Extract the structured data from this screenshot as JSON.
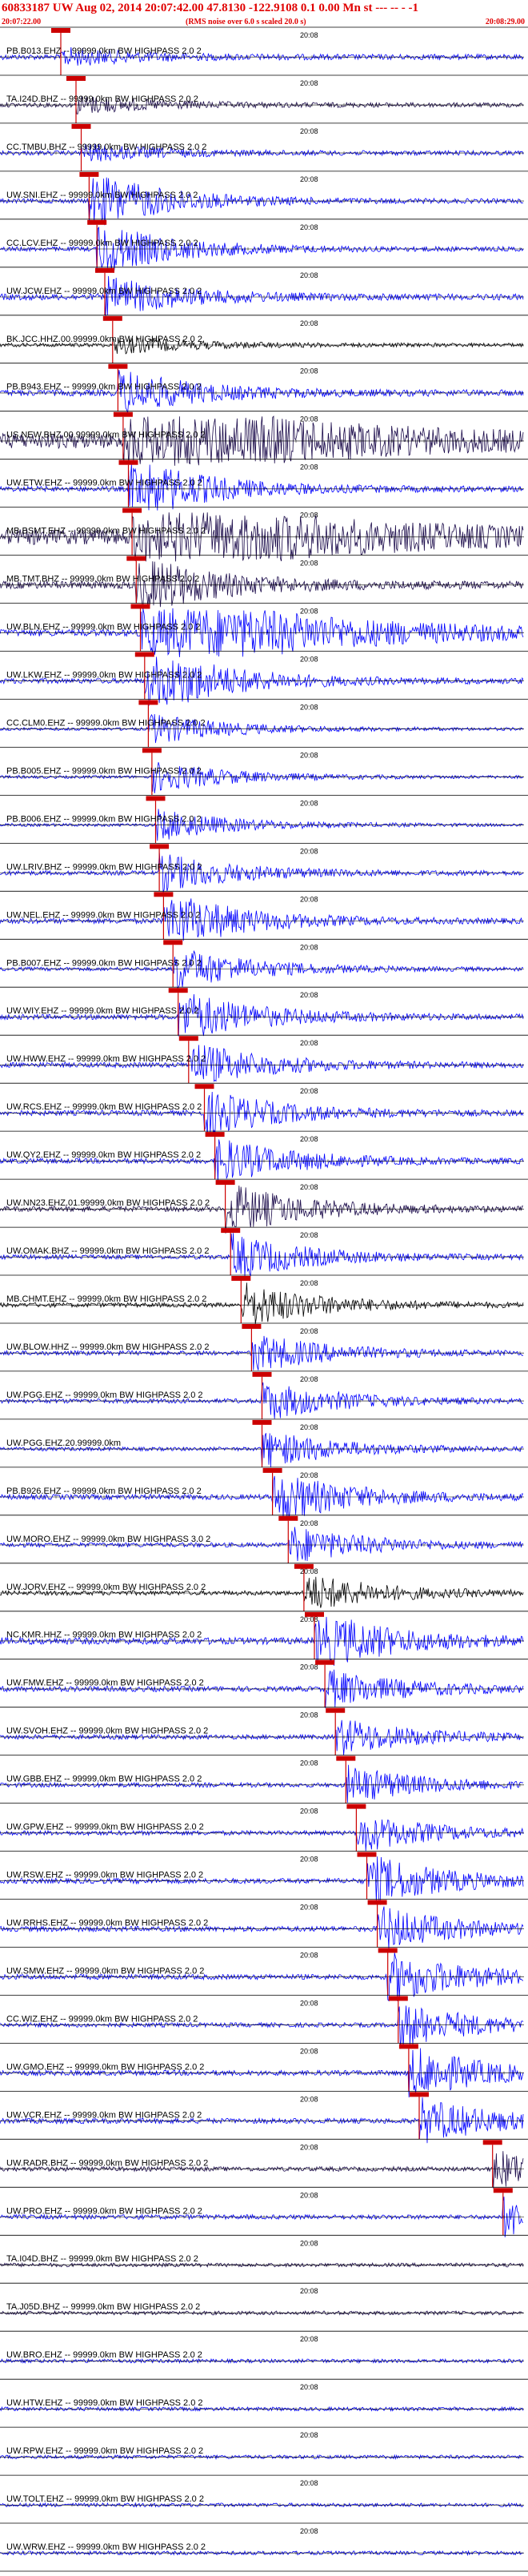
{
  "header": {
    "title": "60833187 UW Aug 02, 2014 20:07:42.00    47.8130  -122.9108   0.1  0.00  Mn  st --- --  -  -1",
    "start_time": "20:07:22.00",
    "note": "(RMS noise over 6.0 s scaled 20.0 s)",
    "end_time": "20:08:29.00"
  },
  "colors": {
    "header": "#e00000",
    "blue": "#0000ff",
    "black": "#000000",
    "purple": "#1a0a4a",
    "marker": "#cc0000"
  },
  "chart_data": {
    "type": "seismogram",
    "time_tick_label": "20:08",
    "traces": [
      {
        "label": "PB.B013.EHZ -- 99999.0km BW  HIGHPASS  2.0  2",
        "color": "blue",
        "pick": 0.116,
        "amp": 0.35,
        "burst": 0.0
      },
      {
        "label": "TA.I24D.BHZ -- 99999.0km BW  HIGHPASS  2.0  2",
        "color": "purple",
        "pick": 0.145,
        "amp": 0.3,
        "burst": 0.0
      },
      {
        "label": "CC.TMBU.BHZ -- 99999.0km BW  HIGHPASS  2.0  2",
        "color": "blue",
        "pick": 0.155,
        "amp": 0.3,
        "burst": 0.0
      },
      {
        "label": "UW.SNI.EHZ -- 99999.0km BW  HIGHPASS  2.0  2",
        "color": "blue",
        "pick": 0.17,
        "amp": 0.3,
        "burst": 0.6
      },
      {
        "label": "CC.LCV.EHZ -- 99999.0km BW  HIGHPASS  2.0  2",
        "color": "blue",
        "pick": 0.185,
        "amp": 0.3,
        "burst": 0.5
      },
      {
        "label": "UW.JCW.EHZ -- 99999.0km BW  HIGHPASS  2.0  2",
        "color": "blue",
        "pick": 0.2,
        "amp": 0.4,
        "burst": 0.3
      },
      {
        "label": "BK.JCC.HHZ.00.99999.0km BW  HIGHPASS  2.0  2",
        "color": "black",
        "pick": 0.215,
        "amp": 0.25,
        "burst": 0.0
      },
      {
        "label": "PB.B943.EHZ -- 99999.0km BW  HIGHPASS  2.0  2",
        "color": "blue",
        "pick": 0.225,
        "amp": 0.4,
        "burst": 0.4
      },
      {
        "label": "US.NEW.BHZ.00.99999.0km BW  HIGHPASS  2.0  2",
        "color": "purple",
        "pick": 0.235,
        "amp": 1.0,
        "burst": 1.0
      },
      {
        "label": "UW.ETW.EHZ -- 99999.0km BW  HIGHPASS  2.0  2",
        "color": "blue",
        "pick": 0.245,
        "amp": 0.35,
        "burst": 0.7
      },
      {
        "label": "MB.BSMT.EHZ -- 99999.0km BW  HIGHPASS  2.0  2",
        "color": "purple",
        "pick": 0.252,
        "amp": 1.0,
        "burst": 1.0
      },
      {
        "label": "MB.TMT.BHZ -- 99999.0km BW  HIGHPASS  2.0  2",
        "color": "purple",
        "pick": 0.26,
        "amp": 0.5,
        "burst": 0.6
      },
      {
        "label": "UW.BLN.EHZ -- 99999.0km BW  HIGHPASS  2.0  2",
        "color": "blue",
        "pick": 0.268,
        "amp": 0.45,
        "burst": 1.0
      },
      {
        "label": "UW.LKW.EHZ -- 99999.0km BW  HIGHPASS  2.0  2",
        "color": "blue",
        "pick": 0.276,
        "amp": 0.35,
        "burst": 0.8
      },
      {
        "label": "CC.CLM0.EHZ -- 99999.0km BW  HIGHPASS  2.0  2",
        "color": "blue",
        "pick": 0.283,
        "amp": 0.2,
        "burst": 0.2
      },
      {
        "label": "PB.B005.EHZ -- 99999.0km BW  HIGHPASS  2.0  2",
        "color": "blue",
        "pick": 0.29,
        "amp": 0.2,
        "burst": 0.2
      },
      {
        "label": "PB.B006.EHZ -- 99999.0km BW  HIGHPASS  2.0  2",
        "color": "blue",
        "pick": 0.297,
        "amp": 0.2,
        "burst": 0.2
      },
      {
        "label": "UW.LRIV.BHZ -- 99999.0km BW  HIGHPASS  2.0  2",
        "color": "blue",
        "pick": 0.304,
        "amp": 0.3,
        "burst": 0.3
      },
      {
        "label": "UW.NEL.EHZ -- 99999.0km BW  HIGHPASS  2.0  2",
        "color": "blue",
        "pick": 0.312,
        "amp": 0.35,
        "burst": 0.6
      },
      {
        "label": "PB.B007.EHZ -- 99999.0km BW  HIGHPASS  2.0  2",
        "color": "blue",
        "pick": 0.33,
        "amp": 0.25,
        "burst": 0.4
      },
      {
        "label": "UW.WIY.EHZ -- 99999.0km BW  HIGHPASS  2.0  2",
        "color": "blue",
        "pick": 0.34,
        "amp": 0.35,
        "burst": 0.5
      },
      {
        "label": "UW.HWW.EHZ -- 99999.0km BW  HIGHPASS  2.0  2",
        "color": "blue",
        "pick": 0.36,
        "amp": 0.35,
        "burst": 0.4
      },
      {
        "label": "UW.RCS.EHZ -- 99999.0km BW  HIGHPASS  2.0  2",
        "color": "blue",
        "pick": 0.39,
        "amp": 0.35,
        "burst": 0.4
      },
      {
        "label": "UW.QY2.EHZ -- 99999.0km BW  HIGHPASS  2.0  2",
        "color": "blue",
        "pick": 0.41,
        "amp": 0.35,
        "burst": 0.4
      },
      {
        "label": "UW.NN23.EHZ.01.99999.0km BW  HIGHPASS  2.0  2",
        "color": "purple",
        "pick": 0.43,
        "amp": 0.35,
        "burst": 0.5
      },
      {
        "label": "UW.OMAK.BHZ -- 99999.0km BW  HIGHPASS  2.0  2",
        "color": "blue",
        "pick": 0.44,
        "amp": 0.3,
        "burst": 0.4
      },
      {
        "label": "MB.CHMT.EHZ -- 99999.0km BW  HIGHPASS  2.0  2",
        "color": "black",
        "pick": 0.46,
        "amp": 0.3,
        "burst": 0.4
      },
      {
        "label": "UW.BLOW.HHZ -- 99999.0km BW  HIGHPASS  2.0  2",
        "color": "blue",
        "pick": 0.48,
        "amp": 0.3,
        "burst": 0.3
      },
      {
        "label": "UW.PGG.EHZ -- 99999.0km BW  HIGHPASS  2.0  2",
        "color": "blue",
        "pick": 0.5,
        "amp": 0.3,
        "burst": 0.3
      },
      {
        "label": "UW.PGG.EHZ.20.99999.0km",
        "color": "blue",
        "pick": 0.5,
        "amp": 0.25,
        "burst": 0.3
      },
      {
        "label": "PB.B926.EHZ -- 99999.0km BW  HIGHPASS  2.0  2",
        "color": "blue",
        "pick": 0.52,
        "amp": 0.35,
        "burst": 0.5
      },
      {
        "label": "UW.MORO.EHZ -- 99999.0km BW  HIGHPASS  3.0  2",
        "color": "blue",
        "pick": 0.55,
        "amp": 0.3,
        "burst": 0.3
      },
      {
        "label": "UW.JORV.EHZ -- 99999.0km BW  HIGHPASS  2.0  2",
        "color": "black",
        "pick": 0.58,
        "amp": 0.3,
        "burst": 0.3
      },
      {
        "label": "NC.KMR.HHZ -- 99999.0km BW  HIGHPASS  2.0  2",
        "color": "blue",
        "pick": 0.6,
        "amp": 0.45,
        "burst": 0.6
      },
      {
        "label": "UW.FMW.EHZ -- 99999.0km BW  HIGHPASS  2.0  2",
        "color": "blue",
        "pick": 0.62,
        "amp": 0.35,
        "burst": 0.3
      },
      {
        "label": "UW.SVOH.EHZ -- 99999.0km BW  HIGHPASS  2.0  2",
        "color": "blue",
        "pick": 0.64,
        "amp": 0.3,
        "burst": 0.3
      },
      {
        "label": "UW.GBB.EHZ -- 99999.0km BW  HIGHPASS  2.0  2",
        "color": "blue",
        "pick": 0.66,
        "amp": 0.3,
        "burst": 0.3
      },
      {
        "label": "UW.GPW.EHZ -- 99999.0km BW  HIGHPASS  2.0  2",
        "color": "blue",
        "pick": 0.68,
        "amp": 0.3,
        "burst": 0.3
      },
      {
        "label": "UW.RSW.EHZ -- 99999.0km BW  HIGHPASS  2.0  2",
        "color": "blue",
        "pick": 0.7,
        "amp": 0.35,
        "burst": 0.5
      },
      {
        "label": "UW.RRHS.EHZ -- 99999.0km BW  HIGHPASS  2.0  2",
        "color": "blue",
        "pick": 0.72,
        "amp": 0.35,
        "burst": 0.4
      },
      {
        "label": "UW.SMW.EHZ -- 99999.0km BW  HIGHPASS  2.0  2",
        "color": "blue",
        "pick": 0.74,
        "amp": 0.35,
        "burst": 0.5
      },
      {
        "label": "CC.WIZ.EHZ -- 99999.0km BW  HIGHPASS  2.0  2",
        "color": "blue",
        "pick": 0.76,
        "amp": 0.3,
        "burst": 0.4
      },
      {
        "label": "UW.GMO.EHZ -- 99999.0km BW  HIGHPASS  2.0  2",
        "color": "blue",
        "pick": 0.78,
        "amp": 0.35,
        "burst": 0.5
      },
      {
        "label": "UW.VCR.EHZ -- 99999.0km BW  HIGHPASS  2.0  2",
        "color": "blue",
        "pick": 0.8,
        "amp": 0.35,
        "burst": 0.4
      },
      {
        "label": "UW.RADR.BHZ -- 99999.0km BW  HIGHPASS  2.0  2",
        "color": "purple",
        "pick": 0.94,
        "amp": 0.3,
        "burst": 0.3
      },
      {
        "label": "UW.PRO.EHZ -- 99999.0km BW  HIGHPASS  2.0  2",
        "color": "blue",
        "pick": 0.96,
        "amp": 0.3,
        "burst": 0.3
      },
      {
        "label": "TA.I04D.BHZ -- 99999.0km BW  HIGHPASS  2.0  2",
        "color": "purple",
        "pick": null,
        "amp": 0.25,
        "burst": 0.0
      },
      {
        "label": "TA.J05D.BHZ -- 99999.0km BW  HIGHPASS  2.0  2",
        "color": "purple",
        "pick": null,
        "amp": 0.25,
        "burst": 0.0
      },
      {
        "label": "UW.BRO.EHZ -- 99999.0km BW  HIGHPASS  2.0  2",
        "color": "blue",
        "pick": null,
        "amp": 0.25,
        "burst": 0.0
      },
      {
        "label": "UW.HTW.EHZ -- 99999.0km BW  HIGHPASS  2.0  2",
        "color": "blue",
        "pick": null,
        "amp": 0.25,
        "burst": 0.0
      },
      {
        "label": "UW.RPW.EHZ -- 99999.0km BW  HIGHPASS  2.0  2",
        "color": "blue",
        "pick": null,
        "amp": 0.25,
        "burst": 0.0
      },
      {
        "label": "UW.TOLT.EHZ -- 99999.0km BW  HIGHPASS  2.0  2",
        "color": "blue",
        "pick": null,
        "amp": 0.25,
        "burst": 0.0
      },
      {
        "label": "UW.WRW.EHZ -- 99999.0km BW  HIGHPASS  2.0  2",
        "color": "blue",
        "pick": null,
        "amp": 0.25,
        "burst": 0.0
      }
    ]
  }
}
